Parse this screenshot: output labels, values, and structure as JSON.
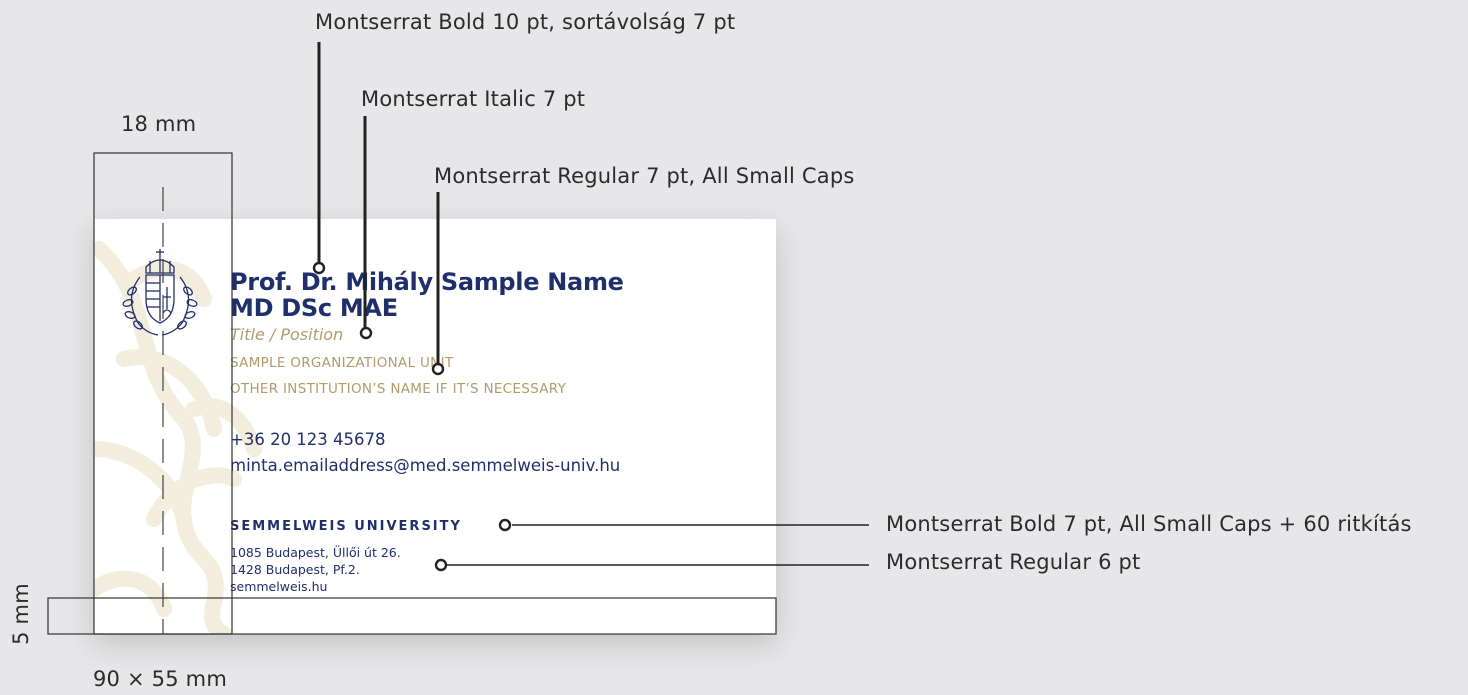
{
  "annotations": {
    "name_font": "Montserrat Bold 10 pt, sortávolság 7 pt",
    "title_font": "Montserrat Italic 7 pt",
    "unit_font": "Montserrat Regular 7 pt, All Small Caps",
    "university_font": "Montserrat Bold 7 pt, All Small Caps + 60 ritkítás",
    "address_font": "Montserrat Regular 6 pt",
    "margin_width": "18 mm",
    "bottom_margin": "5 mm",
    "card_size": "90 × 55 mm"
  },
  "card": {
    "name_line1": "Prof. Dr. Mihály Sample Name",
    "name_line2": "MD DSc MAE",
    "title": "Title / Position",
    "unit": "SAMPLE ORGANIZATIONAL UNIT",
    "institution": "OTHER INSTITUTION’S NAME IF IT’S NECESSARY",
    "phone": "+36 20 123 45678",
    "email": "minta.emailaddress@med.semmelweis-univ.hu",
    "university": "SEMMELWEIS UNIVERSITY",
    "address1": "1085 Budapest, Üllői út 26.",
    "address2": "1428 Budapest, Pf.2.",
    "website": "semmelweis.hu"
  },
  "colors": {
    "navy": "#1f2f6b",
    "gold": "#b39a6c",
    "pattern": "#f3eddd"
  },
  "icons": [
    "coat-of-arms-icon",
    "leaf-pattern"
  ]
}
